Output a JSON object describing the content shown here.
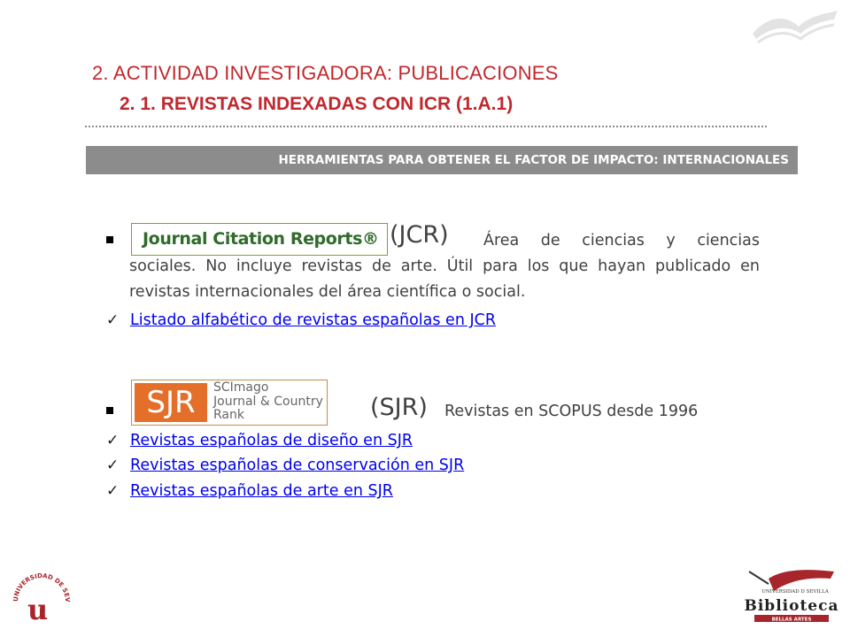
{
  "header": {
    "title_line1": "2. ACTIVIDAD INVESTIGADORA: PUBLICACIONES",
    "title_line2": "2. 1. REVISTAS INDEXADAS CON ICR (1.A.1)"
  },
  "banner": {
    "text": "HERRAMIENTAS PARA OBTENER EL FACTOR DE IMPACTO: INTERNACIONALES"
  },
  "jcr": {
    "logo_text": "Journal Citation Reports®",
    "abbr": "(JCR)",
    "description": "Área de ciencias y ciencias sociales. No incluye revistas de arte. Útil para los que hayan publicado en revistas internacionales del área científica o social.",
    "links": [
      "Listado alfabético de revistas españolas en JCR"
    ]
  },
  "sjr": {
    "logo_main": "SJR",
    "logo_side": [
      "SCImago",
      "Journal & Country",
      "Rank"
    ],
    "abbr": "(SJR)",
    "description": "Revistas en SCOPUS desde 1996",
    "links": [
      "Revistas españolas de diseño en SJR",
      "Revistas españolas de conservación en SJR",
      "Revistas españolas de arte en SJR"
    ]
  },
  "footer": {
    "library_top": "UNIVERSIDAD D SEVILLA",
    "library_name": "Biblioteca",
    "library_sub": "BELLAS ARTES",
    "seal_text": "UNIVERSIDAD DE SEVILLA"
  },
  "colors": {
    "title": "#c0282d",
    "banner": "#8c8c8c",
    "link": "#0000ee",
    "body_text": "#404040",
    "sjr_orange": "#e36f2a"
  }
}
